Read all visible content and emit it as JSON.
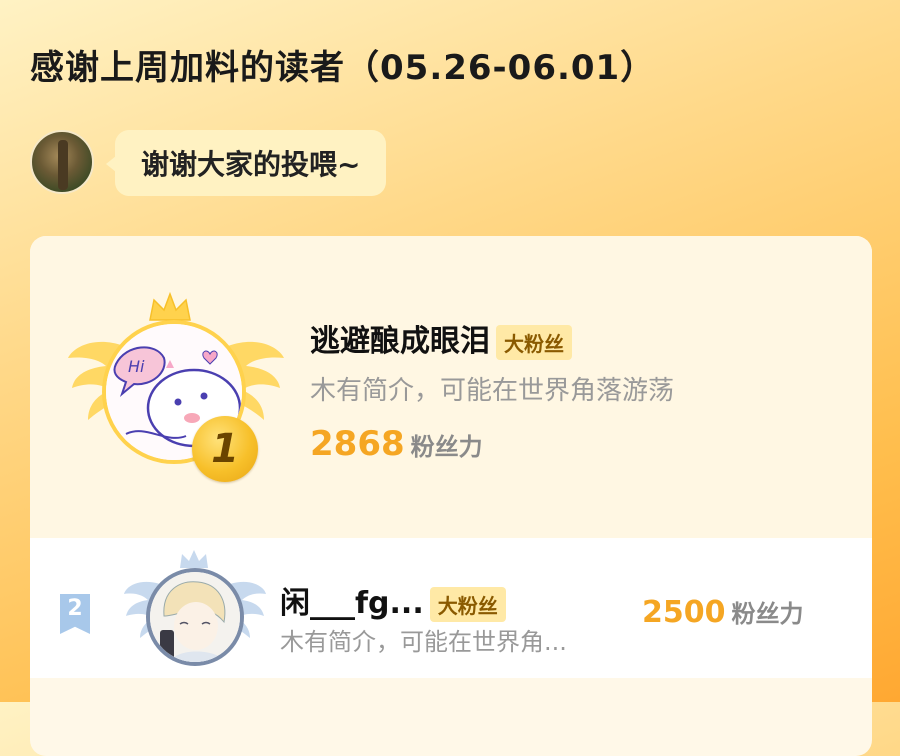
{
  "header": {
    "title": "感谢上周加料的读者（05.26-06.01）"
  },
  "author_message": {
    "text": "谢谢大家的投喂~"
  },
  "leaderboard": {
    "entries": [
      {
        "rank": "1",
        "name": "逃避酿成眼泪",
        "badge": "大粉丝",
        "intro": "木有简介，可能在世界角落游荡",
        "score": "2868",
        "score_unit": "粉丝力"
      },
      {
        "rank": "2",
        "name": "闲___fg...",
        "badge": "大粉丝",
        "intro": "木有简介，可能在世界角...",
        "score": "2500",
        "score_unit": "粉丝力"
      }
    ]
  },
  "colors": {
    "accent_gold": "#f5a623",
    "rank1_ring": "#ffd24d",
    "rank2_tag": "#a8c8ea",
    "badge_bg": "#ffe9a6"
  },
  "icons": {
    "crown": "crown-icon",
    "wings": "wings-icon"
  }
}
